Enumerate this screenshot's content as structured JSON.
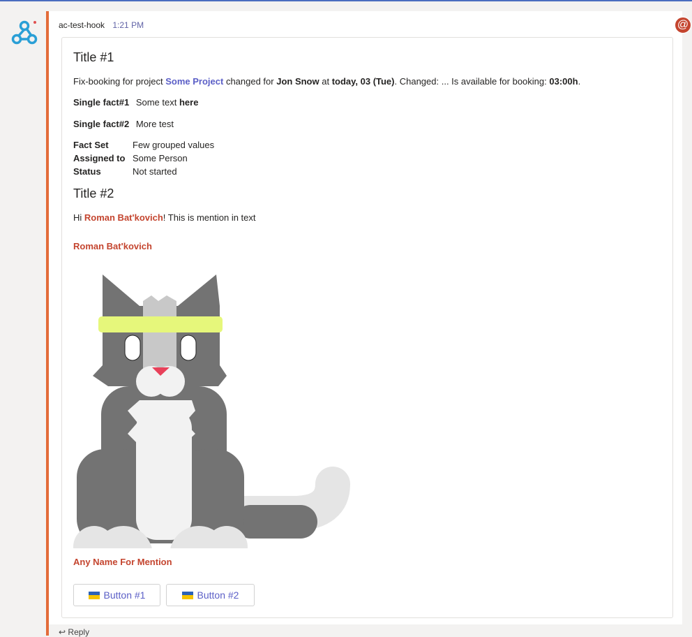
{
  "message": {
    "author": "ac-test-hook",
    "time": "1:21 PM",
    "mention_badge": "@"
  },
  "card": {
    "title1": "Title #1",
    "booking": {
      "p1": "Fix-booking for project ",
      "project": "Some Project",
      "p2": " changed for ",
      "person": "Jon Snow",
      "p3": " at ",
      "date": "today, 03 (Tue)",
      "p4": ". Changed: ... Is available for booking: ",
      "hours": "03:00h",
      "p5": "."
    },
    "fact1": {
      "key": "Single fact#1",
      "value": "Some text ",
      "value_bold": "here"
    },
    "fact2": {
      "key": "Single fact#2",
      "value": "More test"
    },
    "factset": [
      {
        "key": "Fact Set",
        "value": "Few grouped values"
      },
      {
        "key": "Assigned to",
        "value": "Some Person"
      },
      {
        "key": "Status",
        "value": "Not started"
      }
    ],
    "title2": "Title #2",
    "mention_line": {
      "pre": "Hi ",
      "name": "Roman Bat'kovich",
      "post": "! This is mention in text"
    },
    "mention_standalone": "Roman Bat'kovich",
    "mention_any": "Any Name For Mention",
    "buttons": [
      {
        "label": "Button #1"
      },
      {
        "label": "Button #2"
      }
    ]
  },
  "reply_label": "Reply",
  "colors": {
    "accent_border": "#e36c3a",
    "link": "#5b5fc7",
    "mention": "#c4452f",
    "cat_body": "#737373",
    "cat_light": "#f2f2f2",
    "cat_band": "#e6f77b"
  },
  "icons": [
    "webhook-icon",
    "ukraine-flag-icon",
    "reply-arrow-icon",
    "at-mention-icon"
  ]
}
